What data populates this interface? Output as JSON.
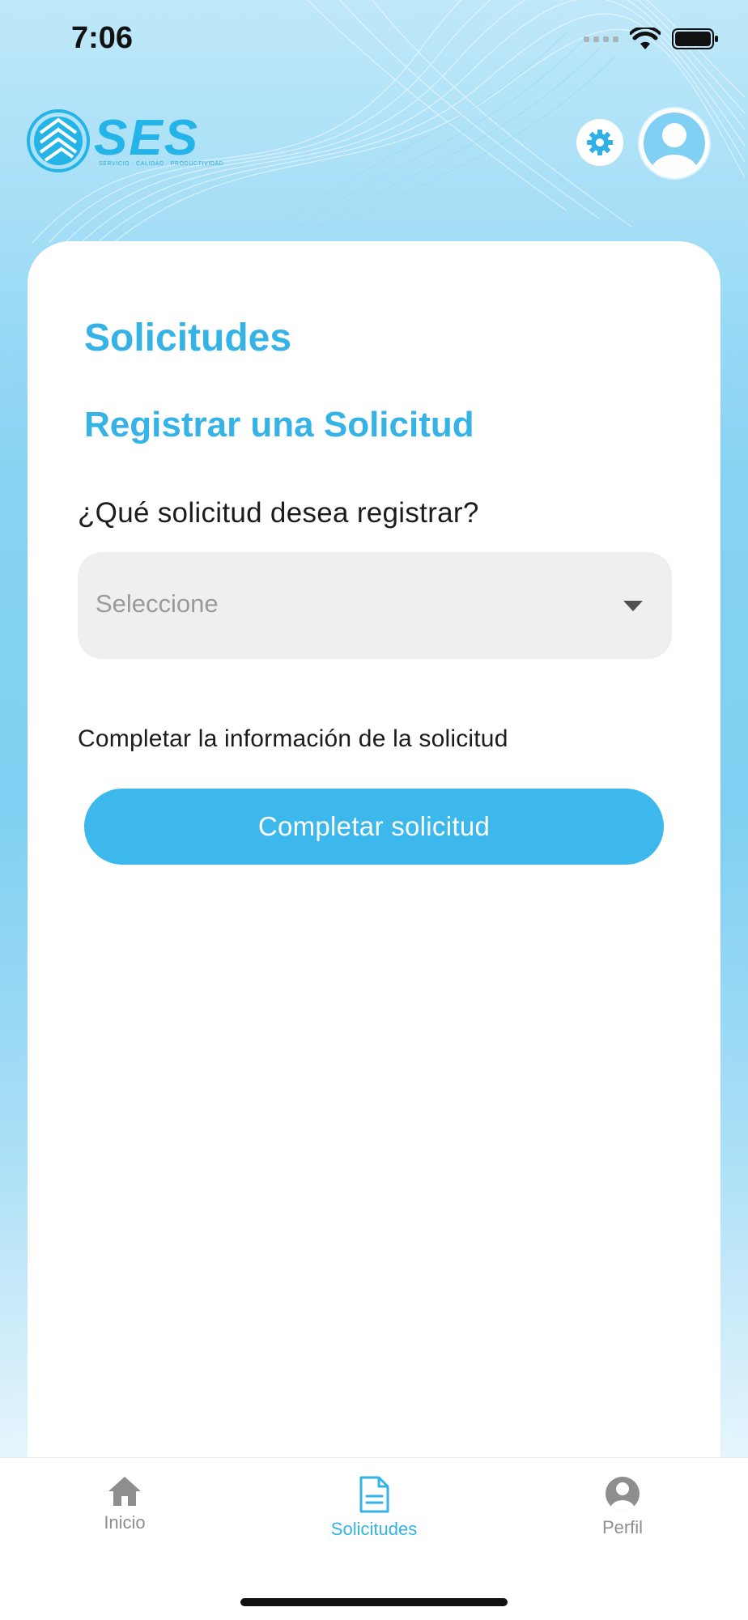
{
  "status_bar": {
    "time": "7:06"
  },
  "brand": {
    "logo_text": "SES",
    "tagline": "SERVICIO · CALIDAD · PRODUCTIVIDAD"
  },
  "header": {
    "settings_icon": "gear-icon",
    "avatar_icon": "user-avatar-icon"
  },
  "main": {
    "page_title": "Solicitudes",
    "section_title": "Registrar una Solicitud",
    "question_label": "¿Qué solicitud desea registrar?",
    "select": {
      "value": "Seleccione"
    },
    "info_text": "Completar la información de la solicitud",
    "primary_button": "Completar solicitud"
  },
  "tabbar": {
    "items": [
      {
        "label": "Inicio",
        "icon": "home-icon",
        "active": false
      },
      {
        "label": "Solicitudes",
        "icon": "document-icon",
        "active": true
      },
      {
        "label": "Perfil",
        "icon": "user-circle-icon",
        "active": false
      }
    ]
  },
  "colors": {
    "accent": "#35b3e6",
    "button": "#3cb8ec",
    "inactive_tab": "#8e8e8e",
    "select_bg": "#efefef"
  }
}
